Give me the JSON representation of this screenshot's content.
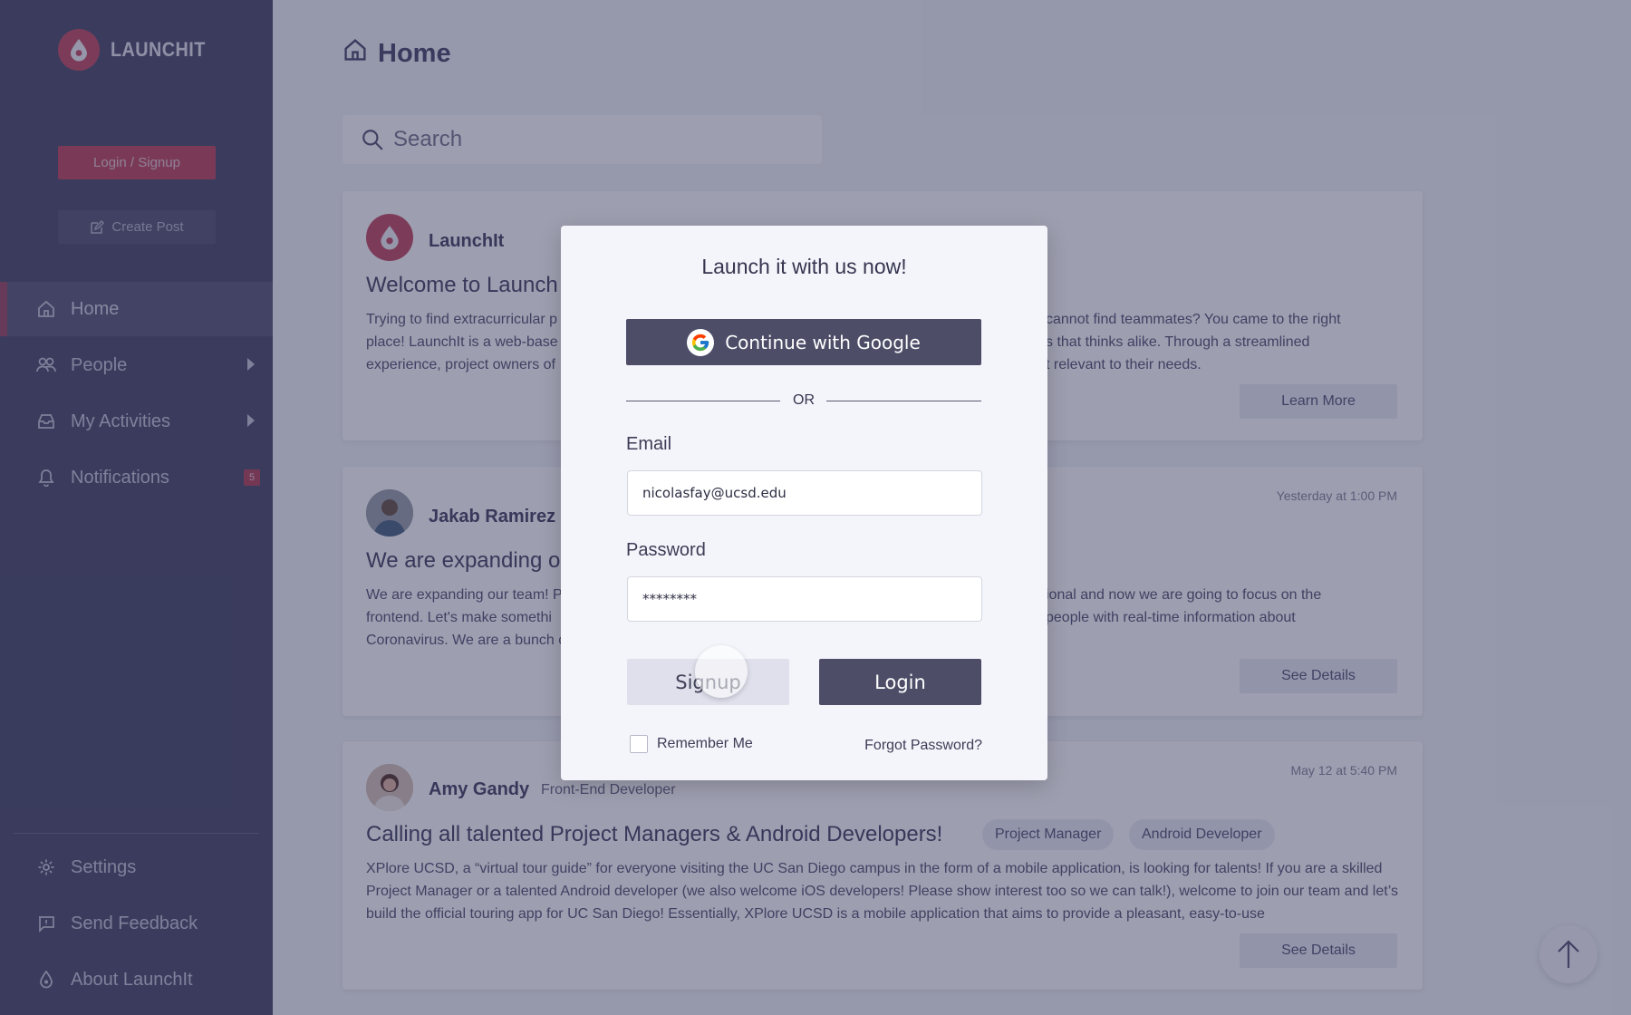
{
  "brand": {
    "name": "LAUNCHIT",
    "accent": "#c55166",
    "sidebar_bg": "#50506e"
  },
  "sidebar": {
    "login_signup": "Login / Signup",
    "create_post": "Create Post",
    "nav": [
      {
        "label": "Home",
        "icon": "home-icon",
        "active": true
      },
      {
        "label": "People",
        "icon": "people-icon",
        "has_submenu": true
      },
      {
        "label": "My Activities",
        "icon": "inbox-icon",
        "has_submenu": true
      },
      {
        "label": "Notifications",
        "icon": "bell-icon",
        "badge": "5"
      }
    ],
    "bottom": [
      {
        "label": "Settings",
        "icon": "gear-icon"
      },
      {
        "label": "Send Feedback",
        "icon": "feedback-icon"
      },
      {
        "label": "About LaunchIt",
        "icon": "launchit-drop-icon"
      }
    ]
  },
  "main": {
    "title": "Home",
    "search_placeholder": "Search",
    "posts": [
      {
        "author": "LaunchIt",
        "title": "Welcome to Launch",
        "body_left": "Trying to find extracurricular p\nplace! LaunchIt is a web-base\nexperience, project owners of",
        "body_right": "cannot find teammates? You came to the right\ns that thinks alike.  Through a streamlined\nt relevant to their needs.",
        "action": "Learn More"
      },
      {
        "author": "Jakab Ramirez",
        "time": "Yesterday at 1:00 PM",
        "title": "We are expanding o",
        "body_left": "We are expanding our team! P\nfrontend. Let's make somethi\nCoronavirus. We are a bunch o",
        "body_right": "ional and now we are going to focus on the\npeople with real-time information about",
        "action": "See Details"
      },
      {
        "author": "Amy Gandy",
        "role": "Front-End Developer",
        "time": "May 12 at 5:40 PM",
        "title": "Calling all talented Project Managers & Android Developers!",
        "tags": [
          "Project Manager",
          "Android Developer"
        ],
        "body": "XPlore UCSD, a “virtual tour guide” for everyone visiting the UC San Diego campus in the form of a mobile application, is looking for talents! If you are a skilled Project Manager or a talented Android developer (we also welcome iOS developers! Please show interest too so we can talk!), welcome to join our team and let’s build the official touring app for UC San Diego! Essentially, XPlore UCSD is a mobile application that aims to provide a pleasant, easy-to-use",
        "action": "See Details"
      }
    ]
  },
  "modal": {
    "title": "Launch it with us now!",
    "google_button": "Continue with Google",
    "divider": "OR",
    "email_label": "Email",
    "email_value": "nicolasfay@ucsd.edu",
    "password_label": "Password",
    "password_value": "********",
    "signup_button": "Signup",
    "login_button": "Login",
    "remember_me": "Remember Me",
    "remember_checked": false,
    "forgot_password": "Forgot Password?"
  }
}
